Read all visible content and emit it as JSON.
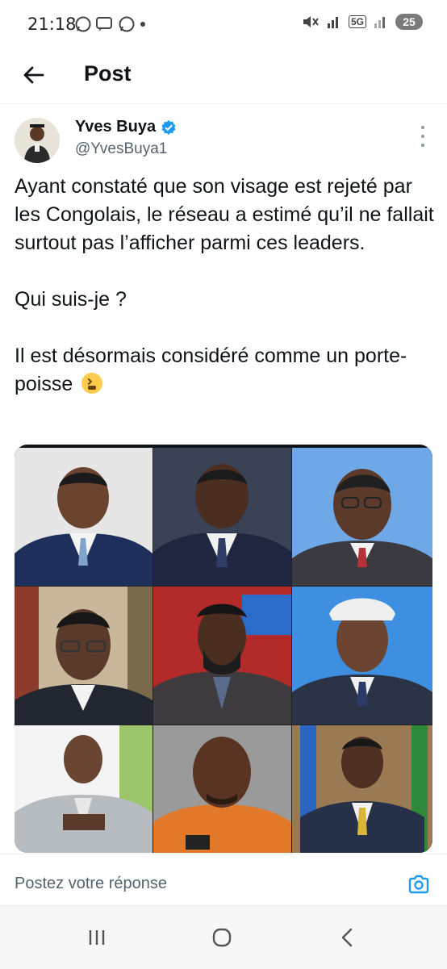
{
  "status_bar": {
    "time": "21:18",
    "battery": "25",
    "network": "5G"
  },
  "header": {
    "title": "Post"
  },
  "tweet": {
    "author_name": "Yves Buya",
    "author_handle": "@YvesBuya1",
    "paragraphs": [
      "Ayant constaté que son visage est rejeté par les Congolais, le réseau a estimé qu’il ne fallait surtout pas l’afficher parmi ces leaders.",
      "Qui suis-je ?",
      "Il est désormais considéré comme un porte-poisse"
    ],
    "emoji": "tired-face-emoji"
  },
  "reply": {
    "placeholder": "Postez votre réponse"
  },
  "colors": {
    "verified": "#1d9bf0",
    "accent": "#1d9bf0",
    "text": "#0f1419",
    "muted": "#536471"
  },
  "icons": [
    "back-arrow-icon",
    "verified-badge-icon",
    "more-vertical-icon",
    "camera-icon",
    "recents-icon",
    "home-icon",
    "back-icon"
  ]
}
